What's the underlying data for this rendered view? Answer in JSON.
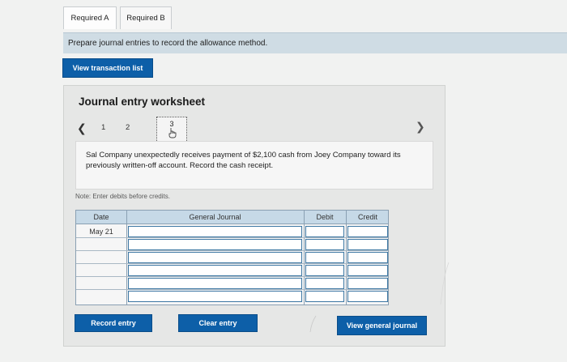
{
  "tabs": [
    {
      "label": "Required A"
    },
    {
      "label": "Required B"
    }
  ],
  "instruction": "Prepare journal entries to record the allowance method.",
  "view_transaction_list_label": "View transaction list",
  "worksheet": {
    "title": "Journal entry worksheet",
    "pager": {
      "prev_icon": "chevron-left-icon",
      "pages": [
        "1",
        "2",
        "3"
      ],
      "current": "3",
      "next_icon": "chevron-right-icon"
    },
    "description": "Sal Company unexpectedly receives payment of $2,100 cash from Joey Company toward its previously written-off account. Record the cash receipt.",
    "note": "Note: Enter debits before credits.",
    "table": {
      "headers": {
        "date": "Date",
        "account": "General Journal",
        "debit": "Debit",
        "credit": "Credit"
      },
      "rows": [
        {
          "date": "May 21"
        },
        {
          "date": ""
        },
        {
          "date": ""
        },
        {
          "date": ""
        },
        {
          "date": ""
        },
        {
          "date": ""
        }
      ]
    }
  },
  "buttons": {
    "record_entry": "Record entry",
    "clear_entry": "Clear entry",
    "view_general_journal": "View general journal"
  },
  "colors": {
    "primary_button": "#0d5fa8",
    "table_header": "#c6d9e7",
    "instruction_bar": "#cfdce4"
  }
}
